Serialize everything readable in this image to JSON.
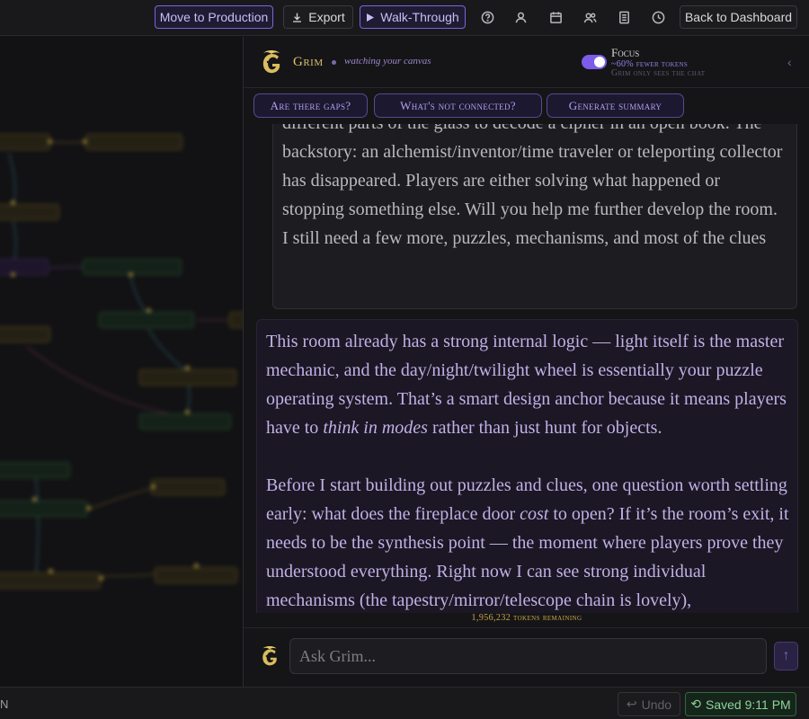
{
  "topbar": {
    "move_to_production": "Move to Production",
    "export": "Export",
    "walkthrough": "Walk-Through",
    "back_to_dashboard": "Back to Dashboard",
    "icons": [
      "help-icon",
      "user-icon",
      "calendar-icon",
      "users-icon",
      "document-icon",
      "clock-icon"
    ]
  },
  "canvas": {
    "nodes": [
      "",
      "",
      "",
      "",
      "",
      "",
      "",
      "",
      "",
      "",
      "",
      "",
      "",
      "",
      ""
    ]
  },
  "panel": {
    "assistant_name": "Grim",
    "assistant_status": "watching your canvas",
    "focus_title": "Focus",
    "focus_line1": "~60% fewer tokens",
    "focus_line2": "Grim only sees the chat",
    "focus_enabled": true,
    "collapse_icon": "chevron-left-icon",
    "chips": [
      "Are there gaps?",
      "What's not connected?",
      "Generate summary"
    ]
  },
  "messages": {
    "user_partial": "different parts of the glass to decode a cipher in an open book. The backstory: an alchemist/inventor/time traveler or teleporting collector has disappeared. Players are either solving what happened or stopping something else. Will you help me further develop the room. I still need a few more, puzzles, mechanisms, and most of the clues",
    "ai_p1_a": "This room already has a strong internal logic — light itself is the master mechanic, and the day/night/twilight wheel is essentially your puzzle operating system. That’s a smart design anchor because it means players have to ",
    "ai_p1_em": "think in modes",
    "ai_p1_b": " rather than just hunt for objects.",
    "ai_p2_a": "Before I start building out puzzles and clues, one question worth settling early: what does the fireplace door ",
    "ai_p2_em": "cost",
    "ai_p2_b": " to open? If it’s the room’s exit, it needs to be the synthesis point — the moment where players prove they understood everything. Right now I can see strong individual mechanisms (the tapestry/mirror/telescope chain is lovely),"
  },
  "tokens_remaining": "1,956,232 tokens remaining",
  "input": {
    "placeholder": "Ask Grim...",
    "send_icon": "arrow-up-icon"
  },
  "bottombar": {
    "left_text": "N",
    "undo": "Undo",
    "saved": "Saved 9:11 PM"
  },
  "colors": {
    "accent_purple": "#7c5ce8",
    "gold": "#dcc36a",
    "saved_green": "#8fd29c"
  }
}
